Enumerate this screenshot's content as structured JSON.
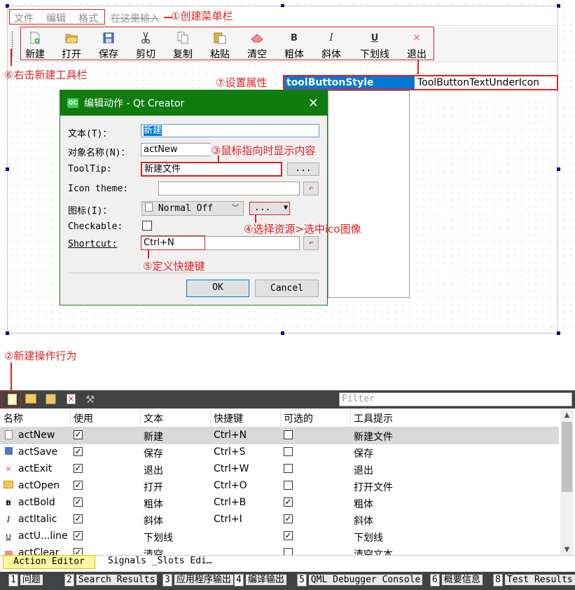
{
  "menubar": {
    "items": [
      "文件",
      "编辑",
      "格式"
    ],
    "placeholder": "在这里输入"
  },
  "toolbar": {
    "buttons": [
      {
        "label": "新建",
        "icon": "new-file-icon"
      },
      {
        "label": "打开",
        "icon": "open-folder-icon"
      },
      {
        "label": "保存",
        "icon": "save-icon"
      },
      {
        "label": "剪切",
        "icon": "scissors-icon"
      },
      {
        "label": "复制",
        "icon": "copy-icon"
      },
      {
        "label": "粘贴",
        "icon": "paste-icon"
      },
      {
        "label": "清空",
        "icon": "eraser-icon"
      },
      {
        "label": "粗体",
        "icon": "bold-icon",
        "glyph": "B"
      },
      {
        "label": "斜体",
        "icon": "italic-icon",
        "glyph": "I"
      },
      {
        "label": "下划线",
        "icon": "underline-icon",
        "glyph": "U"
      },
      {
        "label": "退出",
        "icon": "close-icon",
        "glyph": "✕"
      }
    ]
  },
  "annotations": {
    "a1": "①创建菜单栏",
    "a2": "②新建操作行为",
    "a3": "③鼠标指向时显示内容",
    "a4": "④选择资源>选中ico图像",
    "a5": "⑤定义快捷键",
    "a6": "⑥右击新建工具栏",
    "a7": "⑦设置属性"
  },
  "property": {
    "name": "toolButtonStyle",
    "value": "ToolButtonTextUnderIcon"
  },
  "dialog": {
    "title": "编辑动作 - Qt Creator",
    "text_label": "文本(T)：",
    "text_value": "新建",
    "objname_label": "对象名称(N)：",
    "objname_value": "actNew",
    "tooltip_label": "ToolTip:",
    "tooltip_value": "新建文件",
    "icontheme_label": "Icon theme:",
    "icon_label": "图标(I)：",
    "icon_mode": "Normal Off",
    "icon_browse": "...",
    "checkable_label": "Checkable:",
    "shortcut_label": "Shortcut:",
    "shortcut_value": "Ctrl+N",
    "ellipsis": "...",
    "ok": "OK",
    "cancel": "Cancel"
  },
  "action_editor": {
    "filter_placeholder": "Filter",
    "columns": [
      "名称",
      "使用",
      "文本",
      "快捷键",
      "可选的",
      "工具提示"
    ],
    "rows": [
      {
        "name": "actNew",
        "used": true,
        "text": "新建",
        "shortcut": "Ctrl+N",
        "checkable": false,
        "tooltip": "新建文件",
        "icon": "new-file-icon"
      },
      {
        "name": "actSave",
        "used": true,
        "text": "保存",
        "shortcut": "Ctrl+S",
        "checkable": false,
        "tooltip": "保存",
        "icon": "save-icon"
      },
      {
        "name": "actExit",
        "used": true,
        "text": "退出",
        "shortcut": "Ctrl+W",
        "checkable": false,
        "tooltip": "退出",
        "icon": "close-icon"
      },
      {
        "name": "actOpen",
        "used": true,
        "text": "打开",
        "shortcut": "Ctrl+O",
        "checkable": false,
        "tooltip": "打开文件",
        "icon": "open-folder-icon"
      },
      {
        "name": "actBold",
        "used": true,
        "text": "粗体",
        "shortcut": "Ctrl+B",
        "checkable": true,
        "tooltip": "粗体",
        "icon": "bold-icon"
      },
      {
        "name": "actItalic",
        "used": true,
        "text": "斜体",
        "shortcut": "Ctrl+I",
        "checkable": true,
        "tooltip": "斜体",
        "icon": "italic-icon"
      },
      {
        "name": "actU...line",
        "used": true,
        "text": "下划线",
        "shortcut": "",
        "checkable": true,
        "tooltip": "下划线",
        "icon": "underline-icon"
      },
      {
        "name": "actClear",
        "used": true,
        "text": "清空",
        "shortcut": "",
        "checkable": false,
        "tooltip": "清空文本",
        "icon": "eraser-icon"
      }
    ],
    "tabs": [
      "Action Editor",
      "Signals _Slots Edi…"
    ]
  },
  "output_tabs": [
    {
      "num": "1",
      "label": "问题"
    },
    {
      "num": "2",
      "label": "Search Results"
    },
    {
      "num": "3",
      "label": "应用程序输出"
    },
    {
      "num": "4",
      "label": "编译输出"
    },
    {
      "num": "5",
      "label": "QML Debugger Console"
    },
    {
      "num": "6",
      "label": "概要信息"
    },
    {
      "num": "8",
      "label": "Test Results"
    }
  ],
  "colors": {
    "accent_red": "#e02020",
    "dialog_title": "#107c10",
    "selection": "#0078d7",
    "bottom_bar": "#404244",
    "active_tab": "#fff7a0"
  }
}
